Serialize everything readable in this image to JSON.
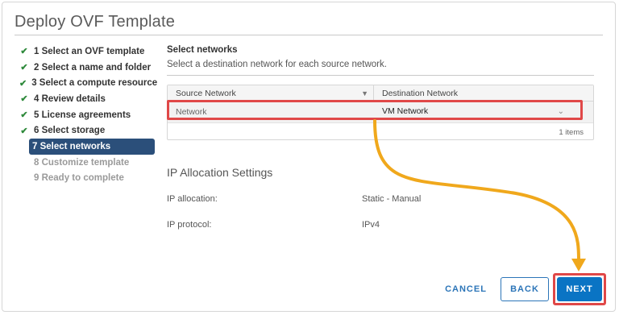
{
  "dialog": {
    "title": "Deploy OVF Template"
  },
  "steps": [
    {
      "label": "1 Select an OVF template",
      "state": "done"
    },
    {
      "label": "2 Select a name and folder",
      "state": "done"
    },
    {
      "label": "3 Select a compute resource",
      "state": "done"
    },
    {
      "label": "4 Review details",
      "state": "done"
    },
    {
      "label": "5 License agreements",
      "state": "done"
    },
    {
      "label": "6 Select storage",
      "state": "done"
    },
    {
      "label": "7 Select networks",
      "state": "active"
    },
    {
      "label": "8 Customize template",
      "state": "future"
    },
    {
      "label": "9 Ready to complete",
      "state": "future"
    }
  ],
  "section": {
    "title": "Select networks",
    "description": "Select a destination network for each source network."
  },
  "grid": {
    "col_source": "Source Network",
    "col_destination": "Destination Network",
    "row_source": "Network",
    "row_destination": "VM Network",
    "footer": "1 items"
  },
  "ip": {
    "title": "IP Allocation Settings",
    "allocation_label": "IP allocation:",
    "allocation_value": "Static - Manual",
    "protocol_label": "IP protocol:",
    "protocol_value": "IPv4"
  },
  "buttons": {
    "cancel": "CANCEL",
    "back": "BACK",
    "next": "NEXT"
  },
  "colors": {
    "highlight": "#e04848",
    "arrow": "#f0a81c",
    "primary": "#0a74c4",
    "active_step": "#2b4f7a"
  },
  "icons": {
    "check": "check-icon",
    "filter": "filter-icon",
    "chevron": "chevron-down-icon"
  }
}
